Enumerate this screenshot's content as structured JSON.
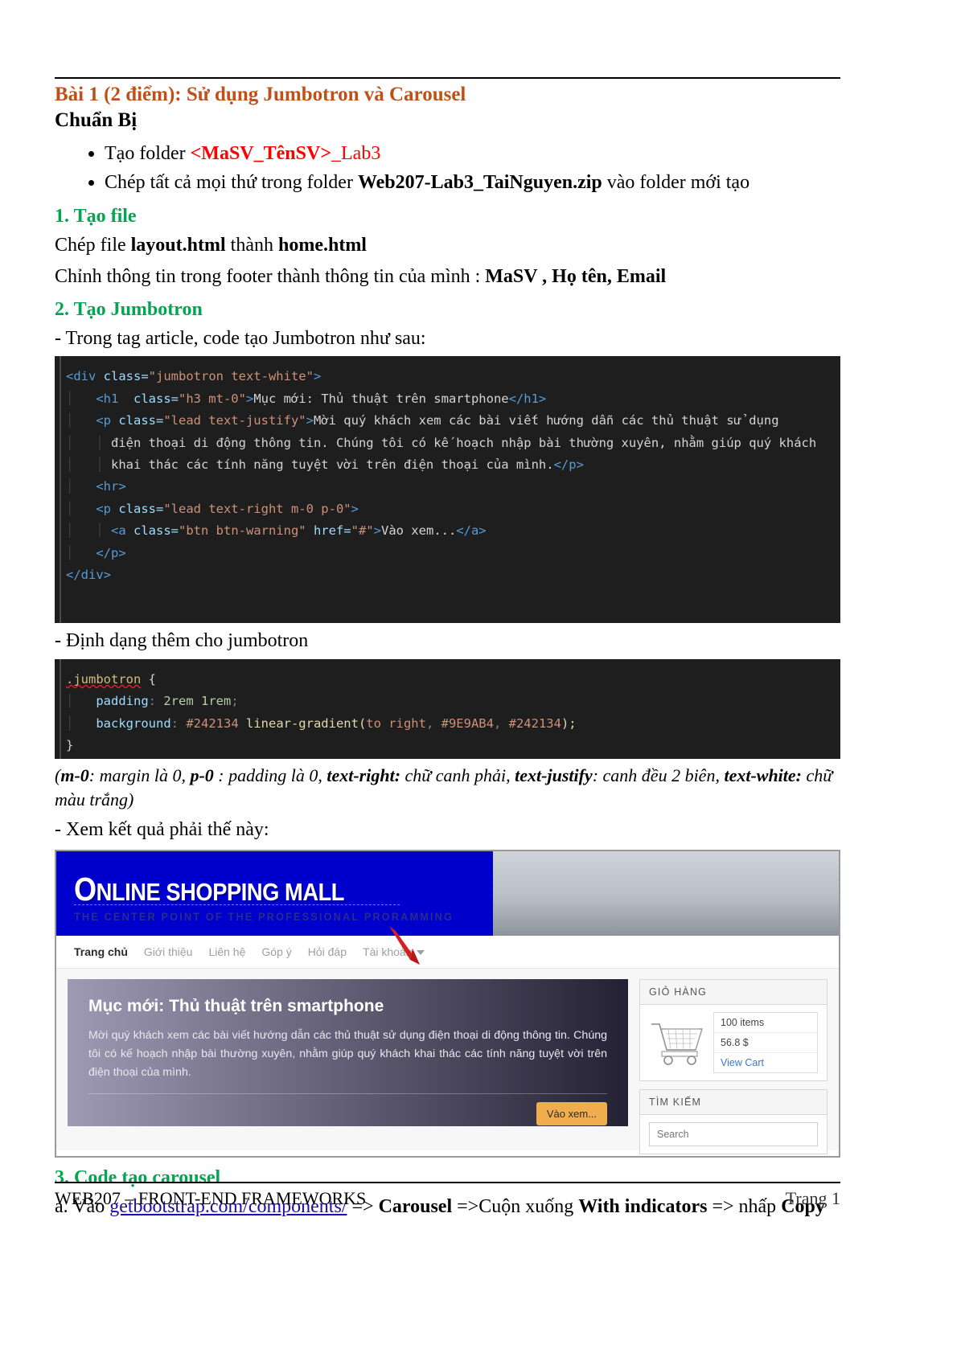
{
  "doc": {
    "title": "Bài 1 (2 điểm): Sử dụng Jumbotron và Carousel",
    "subtitle": "Chuẩn Bị",
    "prep": {
      "item1_pre": "Tạo folder ",
      "item1_red_bold": "<MaSV_TênSV>",
      "item1_red_tail": "_Lab3",
      "item2_pre": "Chép tất cả mọi thứ trong folder ",
      "item2_bold": "Web207-Lab3_TaiNguyen.zip",
      "item2_tail": " vào folder mới tạo"
    },
    "section1": {
      "heading": "1. Tạo file",
      "line1_pre": "Chép file ",
      "line1_b1": "layout.html",
      "line1_mid": " thành ",
      "line1_b2": "home.html",
      "line2_pre": "Chỉnh thông tin trong footer thành thông tin của mình : ",
      "line2_bold": "MaSV , Họ tên, Email"
    },
    "section2": {
      "heading": "2. Tạo Jumbotron",
      "intro": "- Trong tag article, code tạo Jumbotron như sau:",
      "css_intro": "- Định dạng thêm cho jumbotron",
      "result_intro": "- Xem kết quả phải thế này:"
    },
    "note": {
      "open": "(",
      "b1": "m-0",
      "t1": ": margin là 0, ",
      "b2": "p-0",
      "t2": " : padding là 0, ",
      "b3": "text-right:",
      "t3": " chữ canh phải, ",
      "b4": "text-justify",
      "t4": ": canh đều 2 biên, ",
      "b5": "text-white:",
      "t5": " chữ màu trắng)"
    },
    "section3": {
      "heading": "3. Code tạo carousel",
      "a_pre": "a. Vào ",
      "a_link": "getbootstrap.com/components/",
      "a_mid1": " => ",
      "a_b1": "Carousel",
      "a_mid2": " =>Cuộn xuống ",
      "a_b2": "With indicators",
      "a_mid3": " => nhấp ",
      "a_b3": "Copy"
    },
    "footer": {
      "left": "WEB207 – FRONT-END FRAMEWORKS",
      "right": "Trang 1"
    }
  },
  "code_html": {
    "l1_a": "<div ",
    "l1_b": "class=",
    "l1_c": "\"jumbotron text-white\"",
    "l1_d": ">",
    "l2_a": "<h1 ",
    "l2_b": " class=",
    "l2_c": "\"h3 mt-0\"",
    "l2_d": ">",
    "l2_txt": "Mục mới: Thủ thuật trên smartphone",
    "l2_e": "</h1>",
    "l3_a": "<p ",
    "l3_b": "class=",
    "l3_c": "\"lead text-justify\"",
    "l3_d": ">",
    "l3_txt": "Mời quý khách xem các bài viết hướng dẫn các thủ thuật sử dụng",
    "l4_txt": "điện thoại di động thông tin. Chúng tôi có kế hoạch nhập bài thường xuyên, nhằm giúp quý khách",
    "l5_txt": "khai thác các tính năng tuyệt vời trên điện thoại của mình.",
    "l5_e": "</p>",
    "l6": "<hr>",
    "l7_a": "<p ",
    "l7_b": "class=",
    "l7_c": "\"lead text-right m-0 p-0\"",
    "l7_d": ">",
    "l8_a": "<a ",
    "l8_b": "class=",
    "l8_c": "\"btn btn-warning\"",
    "l8_b2": " href=",
    "l8_c2": "\"#\"",
    "l8_d": ">",
    "l8_txt": "Vào xem...",
    "l8_e": "</a>",
    "l9": "</p>",
    "l10": "</div>"
  },
  "code_css": {
    "l1_sel": ".jumbotron",
    "l1_brace": " {",
    "l2_prop": "padding",
    "l2_colon": ": ",
    "l2_val": "2rem 1rem",
    "l2_semi": ";",
    "l3_prop": "background",
    "l3_colon": ": ",
    "l3_hex1": "#242134",
    "l3_fn": " linear-gradient(",
    "l3_to": "to right",
    "l3_sep1": ", ",
    "l3_hex2": "#9E9AB4",
    "l3_sep2": ", ",
    "l3_hex3": "#242134",
    "l3_close": ");",
    "l4": "}"
  },
  "preview": {
    "banner": {
      "title_cap": "O",
      "title_rest": "NLINE SHOPPING MALL",
      "tagline": "THE CENTER POINT OF THE PROFESSIONAL PRORAMMING"
    },
    "nav": [
      {
        "label": "Trang chủ",
        "active": true
      },
      {
        "label": "Giới thiệu",
        "active": false
      },
      {
        "label": "Liên hệ",
        "active": false
      },
      {
        "label": "Góp ý",
        "active": false
      },
      {
        "label": "Hỏi đáp",
        "active": false
      },
      {
        "label": "Tài khoản",
        "active": false,
        "caret": true
      }
    ],
    "jumbotron": {
      "heading": "Mục mới: Thủ thuật trên smartphone",
      "lead": "Mời quý khách xem các bài viết hướng dẫn các thủ thuật sử dụng điện thoại di động thông tin. Chúng tôi có kế hoạch nhập bài thường xuyên, nhằm giúp quý khách khai thác các tính năng tuyệt vời trên điện thoại của mình.",
      "button": "Vào xem..."
    },
    "cart": {
      "heading": "GIỎ HÀNG",
      "items": "100 items",
      "total": "56.8 $",
      "link": "View Cart"
    },
    "search": {
      "heading": "TÌM KIẾM",
      "placeholder": "Search"
    }
  },
  "colors": {
    "title": "#C0501A",
    "section_heading": "#00A651",
    "red": "#FF0000",
    "banner_blue": "#0000CC",
    "jumbo_dark": "#242134",
    "jumbo_light": "#9E9AB4",
    "btn_warning": "#f0ad4e",
    "link": "#1a0dab"
  }
}
